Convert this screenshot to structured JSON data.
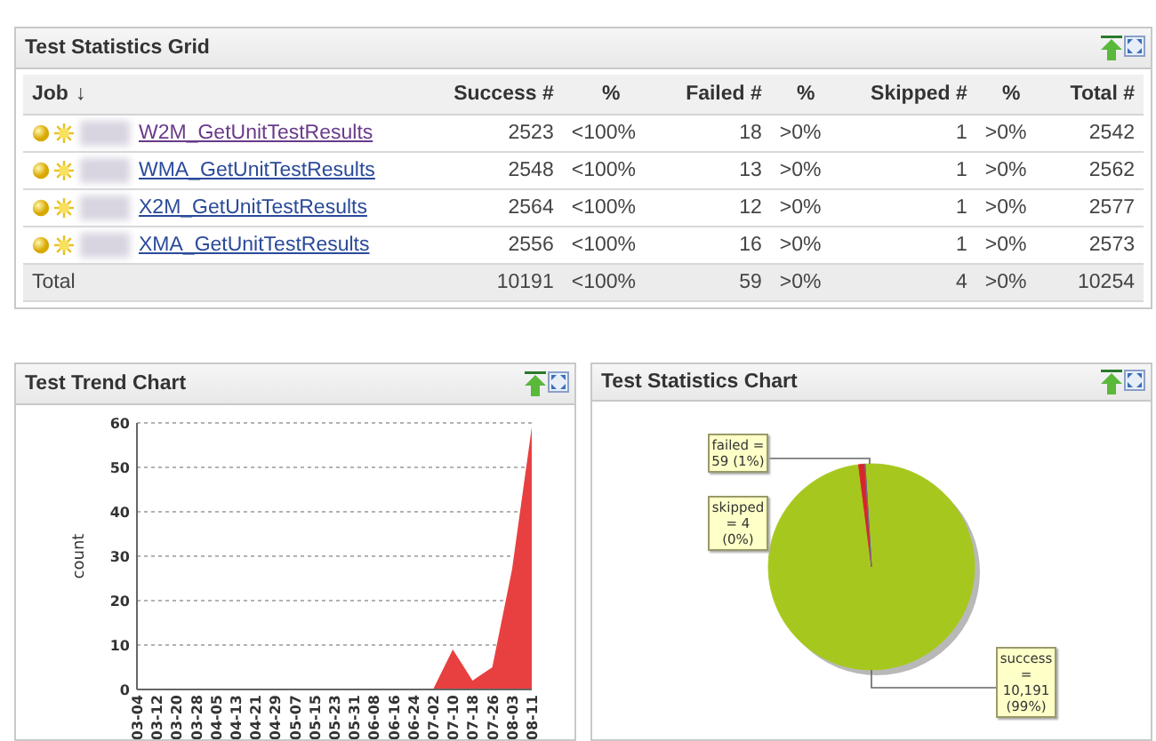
{
  "grid": {
    "title": "Test Statistics Grid",
    "columns": [
      {
        "label": "Job",
        "sort_arrow": "↓"
      },
      {
        "label": "Success #"
      },
      {
        "label": "%"
      },
      {
        "label": "Failed #"
      },
      {
        "label": "%"
      },
      {
        "label": "Skipped #"
      },
      {
        "label": "%"
      },
      {
        "label": "Total #"
      }
    ],
    "rows": [
      {
        "visited": true,
        "cells": [
          "W2M_GetUnitTestResults",
          "2523",
          "<100%",
          "18",
          ">0%",
          "1",
          ">0%",
          "2542"
        ]
      },
      {
        "visited": false,
        "cells": [
          "WMA_GetUnitTestResults",
          "2548",
          "<100%",
          "13",
          ">0%",
          "1",
          ">0%",
          "2562"
        ]
      },
      {
        "visited": false,
        "cells": [
          "X2M_GetUnitTestResults",
          "2564",
          "<100%",
          "12",
          ">0%",
          "1",
          ">0%",
          "2577"
        ]
      },
      {
        "visited": false,
        "cells": [
          "XMA_GetUnitTestResults",
          "2556",
          "<100%",
          "16",
          ">0%",
          "1",
          ">0%",
          "2573"
        ]
      }
    ],
    "total": {
      "cells": [
        "Total",
        "10191",
        "<100%",
        "59",
        ">0%",
        "4",
        ">0%",
        "10254"
      ]
    }
  },
  "trend": {
    "title": "Test Trend Chart",
    "chart_data": {
      "type": "area",
      "ylabel": "count",
      "grid": true,
      "categories": [
        "03-04",
        "03-12",
        "03-20",
        "03-28",
        "04-05",
        "04-13",
        "04-21",
        "04-29",
        "05-07",
        "05-15",
        "05-23",
        "05-31",
        "06-08",
        "06-16",
        "06-24",
        "07-02",
        "07-10",
        "07-18",
        "07-26",
        "08-03",
        "08-11"
      ],
      "series": [
        {
          "color": "#e84040",
          "values": [
            0,
            0,
            0,
            0,
            0,
            0,
            0,
            0,
            0,
            0,
            0,
            0,
            0,
            0,
            0,
            0,
            9,
            2,
            5,
            27,
            59
          ]
        }
      ],
      "ylim": [
        0,
        60
      ],
      "yticks": [
        0,
        10,
        20,
        30,
        40,
        50,
        60
      ]
    }
  },
  "stats": {
    "title": "Test Statistics Chart",
    "chart_data": {
      "type": "pie",
      "series": [
        {
          "values": [
            99,
            1,
            0
          ],
          "colors": [
            "#a6c81e",
            "#d8242c",
            "#6a6a9a"
          ]
        }
      ],
      "value_labels": [
        "success = 10,191 (99%)",
        "failed = 59 (1%)",
        "skipped = 4 (0%)"
      ]
    }
  }
}
